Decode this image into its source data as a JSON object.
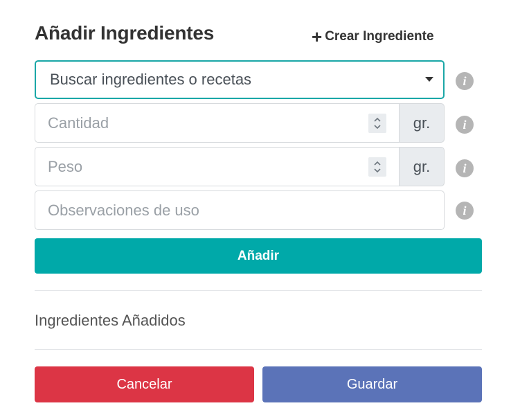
{
  "header": {
    "title": "Añadir Ingredientes",
    "create_link_label": "Crear Ingrediente"
  },
  "form": {
    "search_select": {
      "placeholder": "Buscar ingredientes o recetas"
    },
    "quantity": {
      "placeholder": "Cantidad",
      "unit": "gr."
    },
    "weight": {
      "placeholder": "Peso",
      "unit": "gr."
    },
    "notes": {
      "placeholder": "Observaciones de uso"
    },
    "info_icon_glyph": "i",
    "add_button_label": "Añadir"
  },
  "added_section": {
    "label": "Ingredientes Añadidos"
  },
  "footer": {
    "cancel_label": "Cancelar",
    "save_label": "Guardar"
  },
  "colors": {
    "accent_teal": "#00a9a9",
    "danger": "#dc3545",
    "primary": "#5b73b8",
    "info_gray": "#b5b5b5"
  },
  "icons": {
    "create": "plus-icon",
    "dropdown": "caret-down-icon",
    "spinner": "spinner-arrows-icon",
    "info": "info-icon"
  }
}
